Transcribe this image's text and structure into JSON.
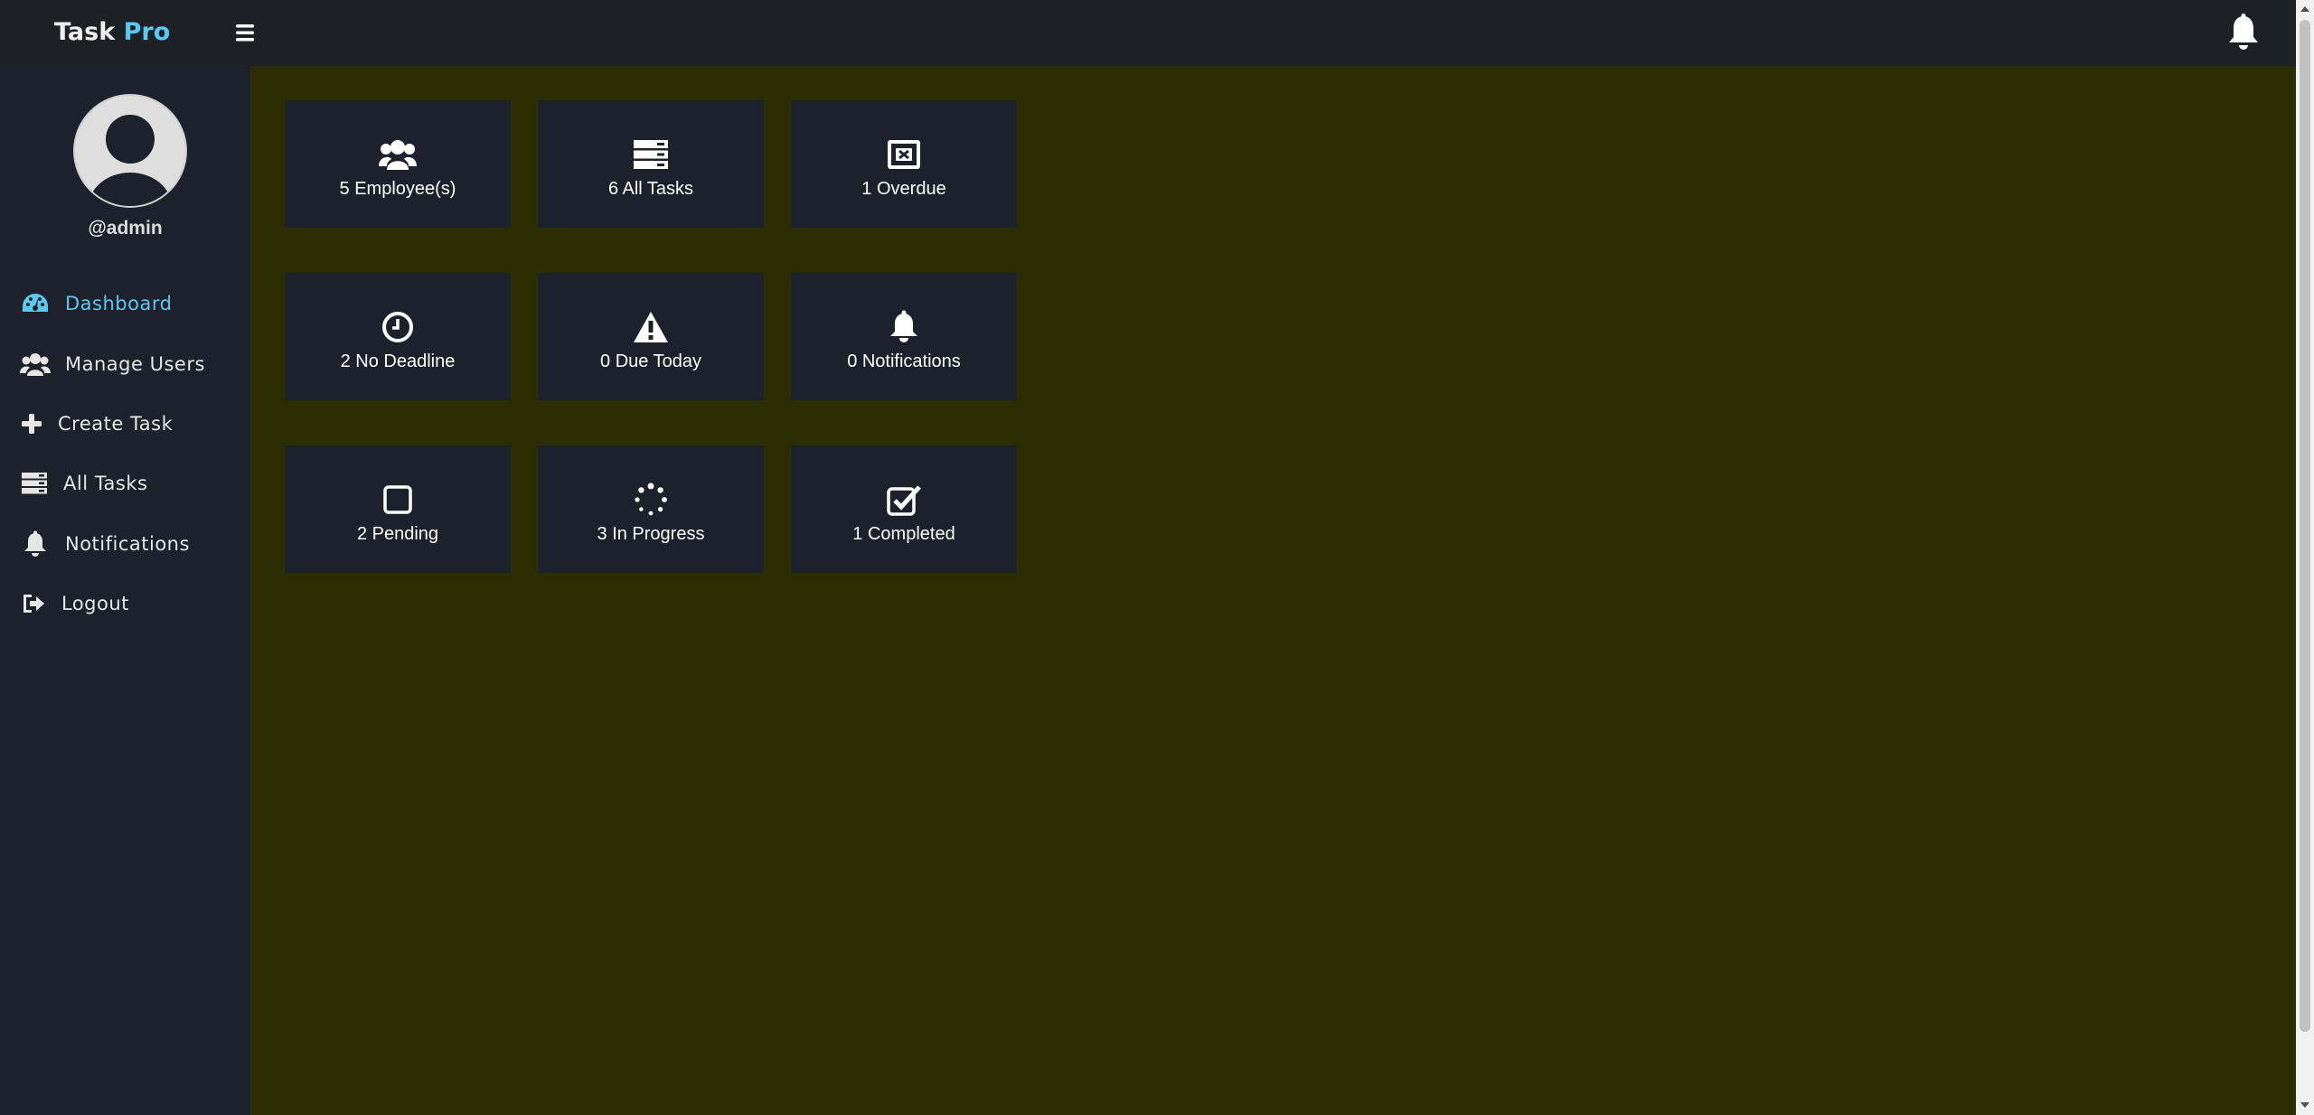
{
  "app": {
    "brand_main": "Task",
    "brand_accent": "Pro",
    "accent_color": "#5bc8ef"
  },
  "topbar": {
    "menu_icon": "hamburger-icon",
    "bell_icon": "bell-icon"
  },
  "sidebar": {
    "username": "@admin",
    "items": [
      {
        "label": "Dashboard",
        "icon": "dashboard-icon",
        "active": true
      },
      {
        "label": "Manage Users",
        "icon": "users-icon",
        "active": false
      },
      {
        "label": "Create Task",
        "icon": "plus-icon",
        "active": false
      },
      {
        "label": "All Tasks",
        "icon": "tasks-icon",
        "active": false
      },
      {
        "label": "Notifications",
        "icon": "bell-icon",
        "active": false
      },
      {
        "label": "Logout",
        "icon": "logout-icon",
        "active": false
      }
    ]
  },
  "cards": [
    {
      "label": "5 Employee(s)",
      "icon": "users-icon"
    },
    {
      "label": "6 All Tasks",
      "icon": "tasks-icon"
    },
    {
      "label": "1 Overdue",
      "icon": "overdue-icon"
    },
    {
      "label": "2 No Deadline",
      "icon": "clock-icon"
    },
    {
      "label": "0 Due Today",
      "icon": "warning-icon"
    },
    {
      "label": "0 Notifications",
      "icon": "bell-icon"
    },
    {
      "label": "2 Pending",
      "icon": "square-icon"
    },
    {
      "label": "3 In Progress",
      "icon": "spinner-icon"
    },
    {
      "label": "1 Completed",
      "icon": "check-square-icon"
    }
  ]
}
